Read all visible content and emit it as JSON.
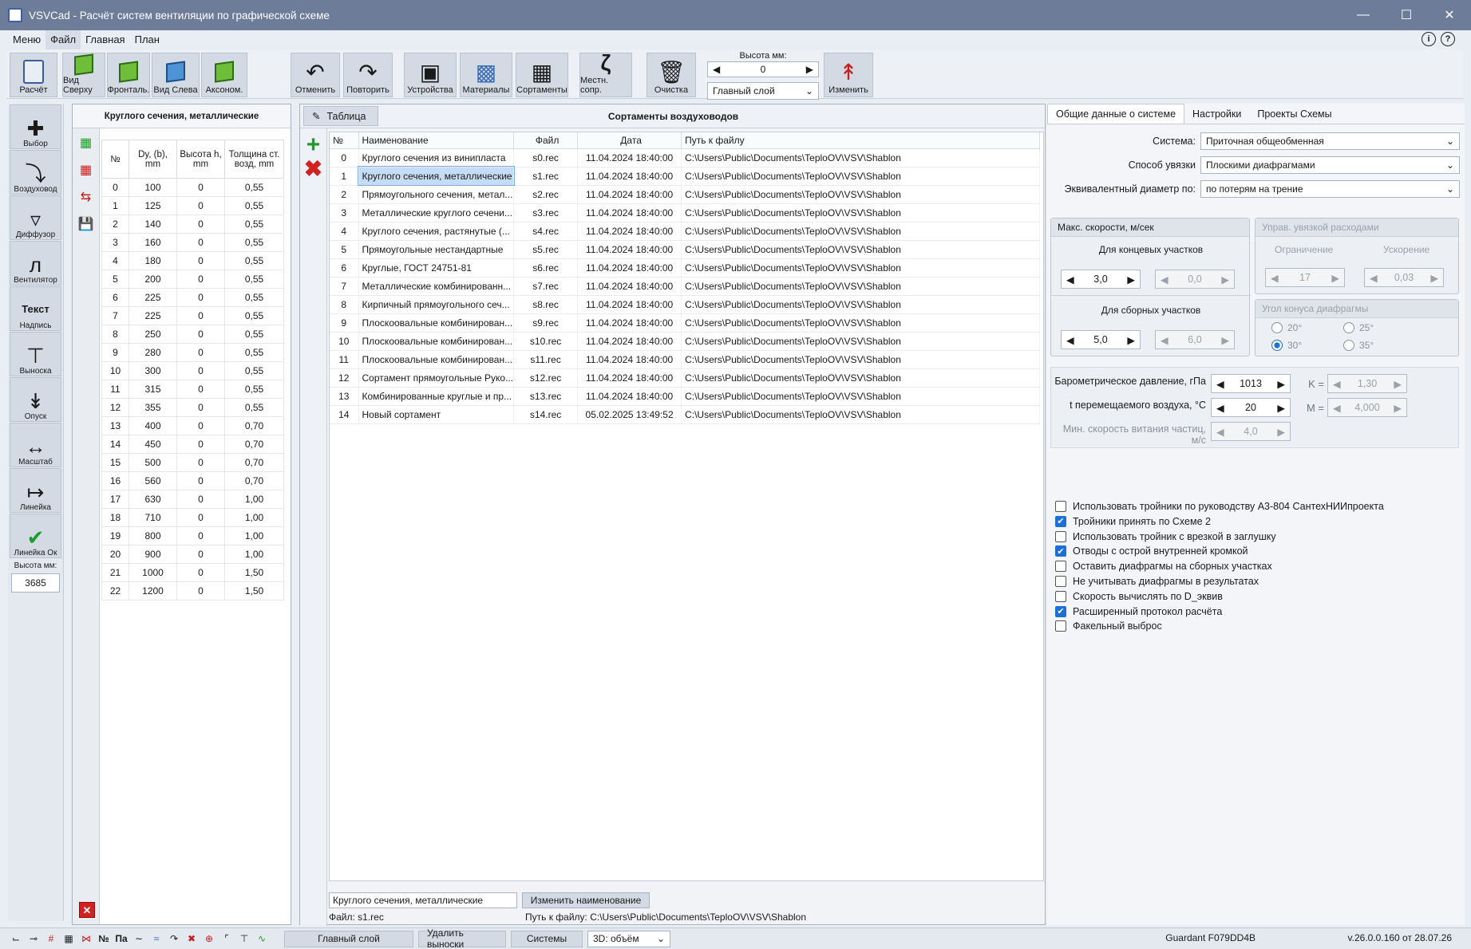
{
  "window": {
    "title": "VSVCad - Расчёт систем вентиляции по графической схеме"
  },
  "menu": [
    "Меню",
    "Файл",
    "Главная",
    "План"
  ],
  "ribbon": {
    "buttons": [
      "Расчёт",
      "Вид Сверху",
      "Фронталь.",
      "Вид Слева",
      "Аксоном.",
      "Отменить",
      "Повторить",
      "Устройства",
      "Материалы",
      "Сортаменты",
      "Местн. сопр.",
      "Очистка",
      "Изменить"
    ],
    "height_label": "Высота мм:",
    "height_value": "0",
    "layer_value": "Главный слой"
  },
  "left_tools": {
    "items": [
      "Выбор",
      "Воздуховод",
      "Диффузор",
      "Вентилятор",
      "Надпись",
      "Выноска",
      "Опуск",
      "Масштаб",
      "Линейка",
      "Линейка Ок"
    ],
    "text_tool_label": "Текст",
    "height_label": "Высота мм:",
    "height_value": "3685"
  },
  "sort_panel": {
    "title": "Круглого сечения, металлические",
    "headers": [
      "№",
      "Dy, (b), mm",
      "Высота h, mm",
      "Толщина ст. возд, mm"
    ],
    "rows": [
      [
        "0",
        "100",
        "0",
        "0,55"
      ],
      [
        "1",
        "125",
        "0",
        "0,55"
      ],
      [
        "2",
        "140",
        "0",
        "0,55"
      ],
      [
        "3",
        "160",
        "0",
        "0,55"
      ],
      [
        "4",
        "180",
        "0",
        "0,55"
      ],
      [
        "5",
        "200",
        "0",
        "0,55"
      ],
      [
        "6",
        "225",
        "0",
        "0,55"
      ],
      [
        "7",
        "225",
        "0",
        "0,55"
      ],
      [
        "8",
        "250",
        "0",
        "0,55"
      ],
      [
        "9",
        "280",
        "0",
        "0,55"
      ],
      [
        "10",
        "300",
        "0",
        "0,55"
      ],
      [
        "11",
        "315",
        "0",
        "0,55"
      ],
      [
        "12",
        "355",
        "0",
        "0,55"
      ],
      [
        "13",
        "400",
        "0",
        "0,70"
      ],
      [
        "14",
        "450",
        "0",
        "0,70"
      ],
      [
        "15",
        "500",
        "0",
        "0,70"
      ],
      [
        "16",
        "560",
        "0",
        "0,70"
      ],
      [
        "17",
        "630",
        "0",
        "1,00"
      ],
      [
        "18",
        "710",
        "0",
        "1,00"
      ],
      [
        "19",
        "800",
        "0",
        "1,00"
      ],
      [
        "20",
        "900",
        "0",
        "1,00"
      ],
      [
        "21",
        "1000",
        "0",
        "1,50"
      ],
      [
        "22",
        "1200",
        "0",
        "1,50"
      ]
    ]
  },
  "main_panel": {
    "tab_label": "Таблица",
    "title": "Сортаменты воздуховодов",
    "headers": [
      "№",
      "Наименование",
      "Файл",
      "Дата",
      "Путь к файлу"
    ],
    "rows": [
      [
        "0",
        "Круглого сечения из винипласта",
        "s0.rec",
        "11.04.2024 18:40:00",
        "C:\\Users\\Public\\Documents\\TeploOV\\VSV\\Shablon"
      ],
      [
        "1",
        "Круглого сечения, металлические",
        "s1.rec",
        "11.04.2024 18:40:00",
        "C:\\Users\\Public\\Documents\\TeploOV\\VSV\\Shablon"
      ],
      [
        "2",
        "Прямоугольного сечения, метал...",
        "s2.rec",
        "11.04.2024 18:40:00",
        "C:\\Users\\Public\\Documents\\TeploOV\\VSV\\Shablon"
      ],
      [
        "3",
        "Металлические круглого сечени...",
        "s3.rec",
        "11.04.2024 18:40:00",
        "C:\\Users\\Public\\Documents\\TeploOV\\VSV\\Shablon"
      ],
      [
        "4",
        "Круглого сечения, растянутые  (...",
        "s4.rec",
        "11.04.2024 18:40:00",
        "C:\\Users\\Public\\Documents\\TeploOV\\VSV\\Shablon"
      ],
      [
        "5",
        "Прямоугольные нестандартные",
        "s5.rec",
        "11.04.2024 18:40:00",
        "C:\\Users\\Public\\Documents\\TeploOV\\VSV\\Shablon"
      ],
      [
        "6",
        "Круглые, ГОСТ 24751-81",
        "s6.rec",
        "11.04.2024 18:40:00",
        "C:\\Users\\Public\\Documents\\TeploOV\\VSV\\Shablon"
      ],
      [
        "7",
        "Металлические комбинированн...",
        "s7.rec",
        "11.04.2024 18:40:00",
        "C:\\Users\\Public\\Documents\\TeploOV\\VSV\\Shablon"
      ],
      [
        "8",
        "Кирпичный прямоугольного сеч...",
        "s8.rec",
        "11.04.2024 18:40:00",
        "C:\\Users\\Public\\Documents\\TeploOV\\VSV\\Shablon"
      ],
      [
        "9",
        "Плоскоовальные комбинирован...",
        "s9.rec",
        "11.04.2024 18:40:00",
        "C:\\Users\\Public\\Documents\\TeploOV\\VSV\\Shablon"
      ],
      [
        "10",
        "Плоскоовальные комбинирован...",
        "s10.rec",
        "11.04.2024 18:40:00",
        "C:\\Users\\Public\\Documents\\TeploOV\\VSV\\Shablon"
      ],
      [
        "11",
        "Плоскоовальные комбинирован...",
        "s11.rec",
        "11.04.2024 18:40:00",
        "C:\\Users\\Public\\Documents\\TeploOV\\VSV\\Shablon"
      ],
      [
        "12",
        "Сортамент прямоугольные Руко...",
        "s12.rec",
        "11.04.2024 18:40:00",
        "C:\\Users\\Public\\Documents\\TeploOV\\VSV\\Shablon"
      ],
      [
        "13",
        "Комбинированные круглые и пр...",
        "s13.rec",
        "11.04.2024 18:40:00",
        "C:\\Users\\Public\\Documents\\TeploOV\\VSV\\Shablon"
      ],
      [
        "14",
        "Новый сортамент",
        "s14.rec",
        "05.02.2025 13:49:52",
        "C:\\Users\\Public\\Documents\\TeploOV\\VSV\\Shablon"
      ]
    ],
    "selected_row": 1,
    "name_value": "Круглого сечения, металлические",
    "rename_button": "Изменить наименование",
    "file_label": "Файл: s1.rec",
    "path_label": "Путь к файлу: C:\\Users\\Public\\Documents\\TeploOV\\VSV\\Shablon"
  },
  "right_panel": {
    "tabs": [
      "Общие данные о системе",
      "Настройки",
      "Проекты Схемы"
    ],
    "system_label": "Система:",
    "system_value": "Приточная общеобменная",
    "link_label": "Способ увязки",
    "link_value": "Плоскими диафрагмами",
    "eqdiam_label": "Эквивалентный диаметр по:",
    "eqdiam_value": "по потерям на трение",
    "maxspeed_title": "Макс. скорости, м/сек",
    "end_sections": "Для концевых участков",
    "end_v1": "3,0",
    "end_v2": "0,0",
    "collect_sections": "Для сборных участков",
    "collect_v1": "5,0",
    "collect_v2": "6,0",
    "flow_title": "Управ. увязкой расходами",
    "limit_label": "Ограничение",
    "limit_value": "17",
    "accel_label": "Ускорение",
    "accel_value": "0,03",
    "cone_title": "Угол конуса диафрагмы",
    "cone_options": [
      "20°",
      "25°",
      "30°",
      "35°"
    ],
    "cone_selected": "30°",
    "baro_label": "Барометрическое давление, гПа",
    "baro_value": "1013",
    "k_label": "K =",
    "k_value": "1,30",
    "temp_label": "t перемещаемого воздуха, °C",
    "temp_value": "20",
    "m_label": "M =",
    "m_value": "4,000",
    "minspeed_label": "Мин. скорость витания частиц, м/с",
    "minspeed_value": "4,0",
    "checks": [
      {
        "label": "Использовать тройники по руководству А3-804 СантехНИИпроекта",
        "checked": false
      },
      {
        "label": "Тройники принять по Схеме 2",
        "checked": true
      },
      {
        "label": "Использовать тройник с врезкой в заглушку",
        "checked": false
      },
      {
        "label": "Отводы с острой внутренней кромкой",
        "checked": true
      },
      {
        "label": "Оставить диафрагмы на сборных участках",
        "checked": false
      },
      {
        "label": "Не учитывать диафрагмы в результатах",
        "checked": false
      },
      {
        "label": "Скорость вычислять по D_эквив",
        "checked": false
      },
      {
        "label": "Расширенный протокол расчёта",
        "checked": true
      },
      {
        "label": "Факельный выброс",
        "checked": false
      }
    ]
  },
  "status": {
    "icon_labels": [
      "№",
      "Па"
    ],
    "layer_button": "Главный слой",
    "delete_callouts": "Удалить выноски",
    "systems": "Системы",
    "view_value": "3D: объём",
    "guardant": "Guardant F079DD4B",
    "version": "v.26.0.0.160 от 28.07.26"
  }
}
